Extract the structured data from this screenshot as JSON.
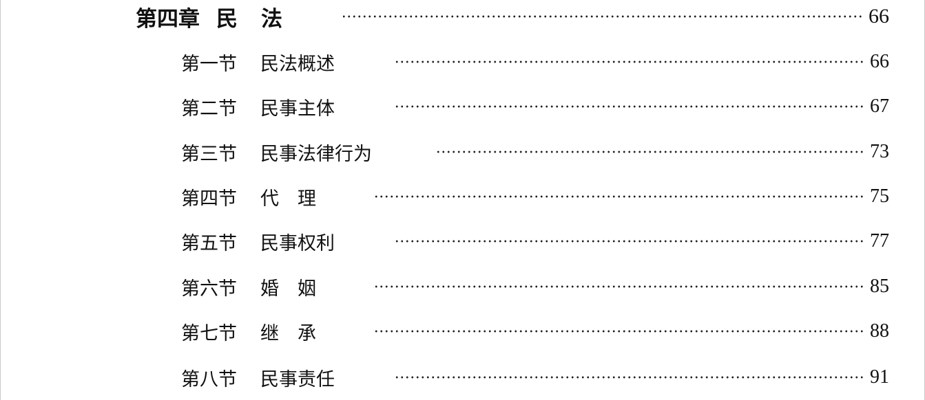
{
  "chapter": {
    "number_label": "第四章",
    "title_chars": [
      "民",
      "法"
    ],
    "page": "66"
  },
  "sections": [
    {
      "label": "第一节",
      "title": "民法概述",
      "page": "66"
    },
    {
      "label": "第二节",
      "title": "民事主体",
      "page": "67"
    },
    {
      "label": "第三节",
      "title": "民事法律行为",
      "page": "73"
    },
    {
      "label": "第四节",
      "title": "代　理",
      "page": "75"
    },
    {
      "label": "第五节",
      "title": "民事权利",
      "page": "77"
    },
    {
      "label": "第六节",
      "title": "婚　姻",
      "page": "85"
    },
    {
      "label": "第七节",
      "title": "继　承",
      "page": "88"
    },
    {
      "label": "第八节",
      "title": "民事责任",
      "page": "91"
    }
  ]
}
